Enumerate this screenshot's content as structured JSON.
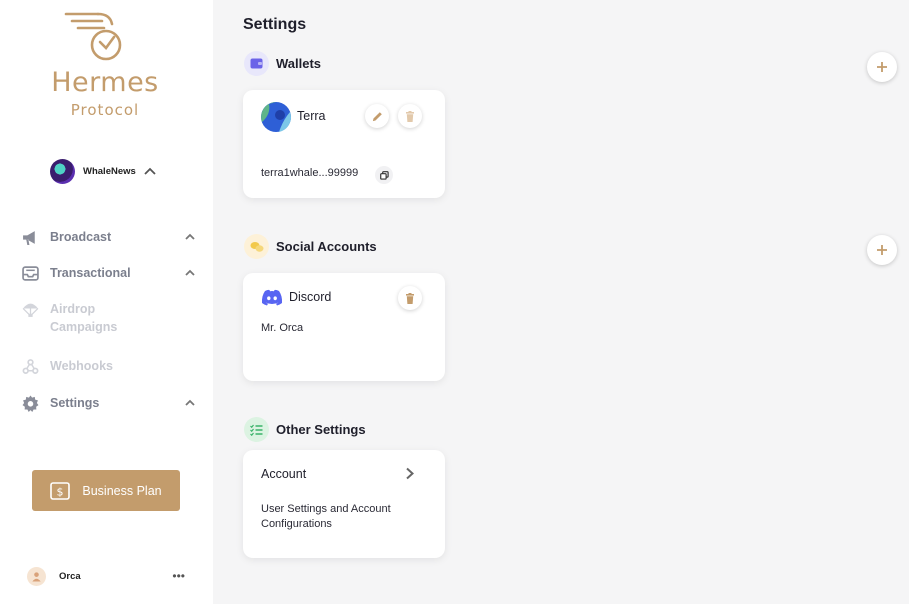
{
  "brand": {
    "name": "Hermes",
    "subtitle": "Protocol",
    "color": "#c39c6c"
  },
  "workspace": {
    "name": "WhaleNews"
  },
  "nav": [
    {
      "label": "Broadcast",
      "icon": "megaphone-icon",
      "expandable": true,
      "enabled": true
    },
    {
      "label": "Transactional",
      "icon": "inbox-icon",
      "expandable": true,
      "enabled": true
    },
    {
      "label": "Airdrop Campaigns",
      "icon": "parachute-icon",
      "expandable": false,
      "enabled": false
    },
    {
      "label": "Webhooks",
      "icon": "webhook-icon",
      "expandable": false,
      "enabled": false
    },
    {
      "label": "Settings",
      "icon": "gear-icon",
      "expandable": true,
      "enabled": true
    }
  ],
  "business_plan": {
    "label": "Business Plan"
  },
  "user": {
    "name": "Orca",
    "more": "•••"
  },
  "page": {
    "title": "Settings"
  },
  "sections": {
    "wallets": {
      "title": "Wallets",
      "icon": "wallet-icon",
      "card": {
        "name": "Terra",
        "address": "terra1whale...99999"
      }
    },
    "social": {
      "title": "Social Accounts",
      "icon": "chat-icon",
      "card": {
        "name": "Discord",
        "handle": "Mr. Orca"
      }
    },
    "other": {
      "title": "Other Settings",
      "icon": "checklist-icon",
      "card": {
        "name": "Account",
        "description": "User Settings and Account Configurations"
      }
    }
  },
  "colors": {
    "accent": "#c39c6c",
    "wallet_icon": "#6b63e8",
    "discord": "#5865f2",
    "chat_icon": "#f2c94c",
    "checklist_icon": "#3bb36b"
  }
}
